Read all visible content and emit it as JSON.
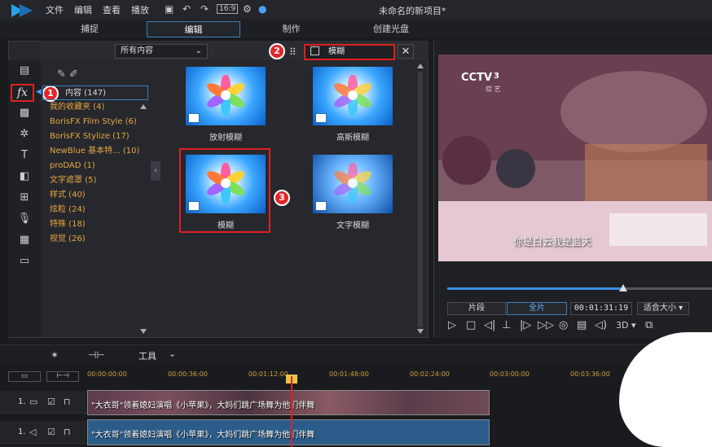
{
  "menu": {
    "items": [
      "文件",
      "编辑",
      "查看",
      "播放"
    ],
    "aspect": "16:9",
    "project_title": "未命名的新项目*"
  },
  "tabs": [
    "捕捉",
    "编辑",
    "制作",
    "创建光盘"
  ],
  "library": {
    "filter_value": "所有内容",
    "search_value": "模糊",
    "categories": [
      "内容 (147)",
      "我的收藏夹 (4)",
      "BorisFX Film Style (6)",
      "BorisFX Stylize (17)",
      "NewBlue 基本特... (10)",
      "proDAD (1)",
      "文字遮罩 (5)",
      "样式 (40)",
      "炫粒 (24)",
      "特殊 (18)",
      "视觉 (26)"
    ],
    "effects": [
      "放射模糊",
      "高斯模糊",
      "模糊",
      "文字模糊"
    ]
  },
  "badges": [
    "1",
    "2",
    "3"
  ],
  "preview": {
    "channel_logo": "CCTV",
    "channel_num": "3",
    "channel_sub": "综 艺",
    "subtitle": "你是白云我是蓝天",
    "mode_clip": "片段",
    "mode_movie": "全片",
    "timecode": "00:01:31:19",
    "size_label": "适合大小",
    "three_d": "3D"
  },
  "timeline": {
    "tool_label": "工具",
    "ticks": [
      "00:00:00:00",
      "00:00:36:00",
      "00:01:12:00",
      "00:01:48:00",
      "00:02:24:00",
      "00:03:00:00",
      "00:03:36:00"
    ],
    "tracks": [
      "1.",
      "1."
    ],
    "clip_title": "\"大衣哥\"领着媳妇演唱《小苹果》，大妈们跳广场舞为他们伴舞"
  },
  "colors": {
    "accent": "#3e7fb8",
    "highlight": "#e02020",
    "category": "#e8a640"
  }
}
